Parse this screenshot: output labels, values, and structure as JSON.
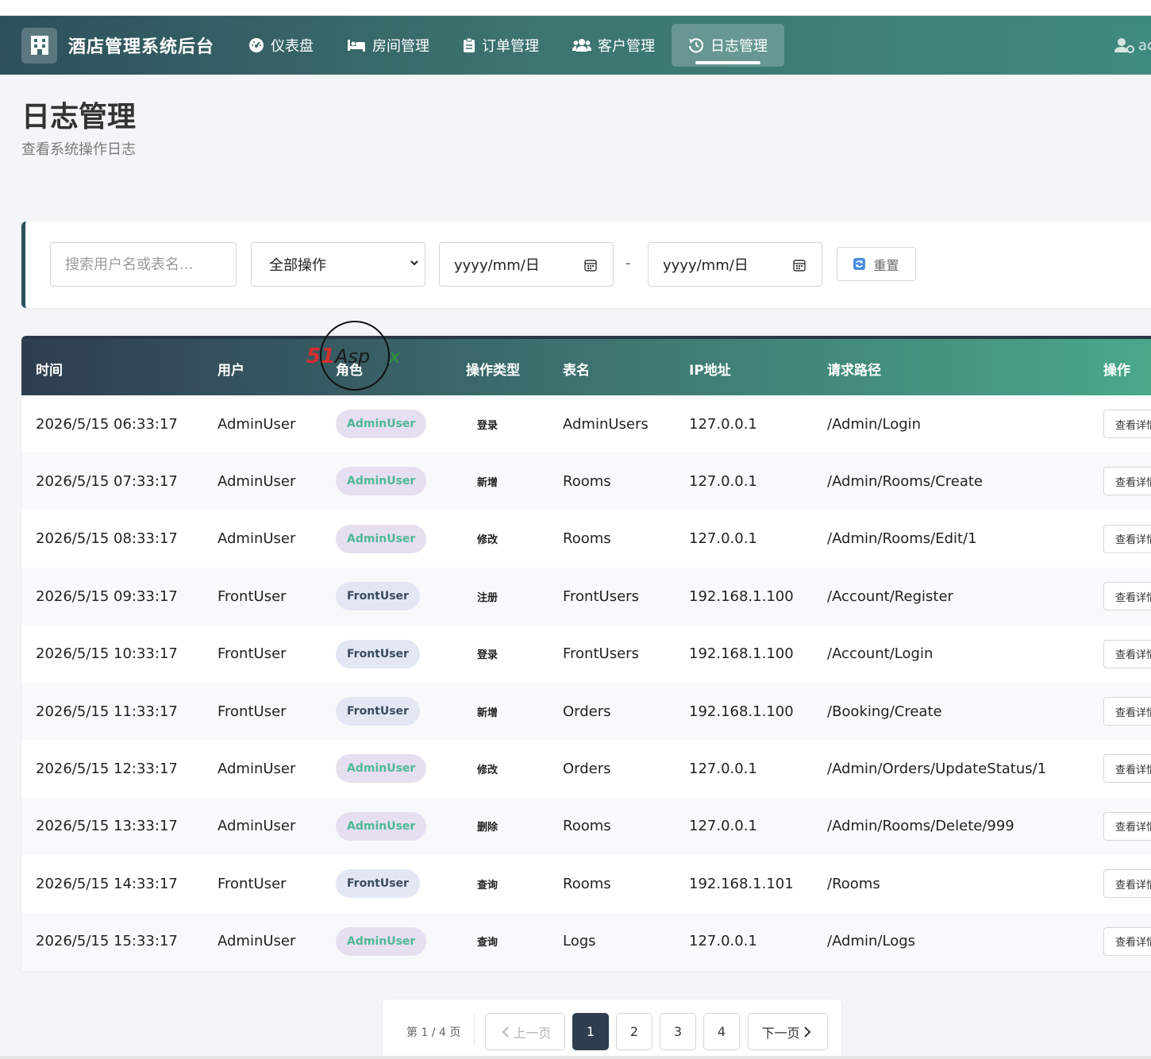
{
  "app": {
    "brand_title": "酒店管理系统后台",
    "user_label": "ac"
  },
  "nav": {
    "items": [
      {
        "label": "仪表盘",
        "icon": "gauge-icon"
      },
      {
        "label": "房间管理",
        "icon": "bed-icon"
      },
      {
        "label": "订单管理",
        "icon": "clipboard-icon"
      },
      {
        "label": "客户管理",
        "icon": "users-icon"
      },
      {
        "label": "日志管理",
        "icon": "history-icon",
        "active": true
      }
    ]
  },
  "page": {
    "title": "日志管理",
    "subtitle": "查看系统操作日志"
  },
  "filters": {
    "search_placeholder": "搜索用户名或表名...",
    "operation_select": "全部操作",
    "date_start": "yyyy/mm/日",
    "date_separator": "-",
    "date_end": "yyyy/mm/日",
    "reset_label": "重置"
  },
  "table": {
    "headers": [
      "时间",
      "用户",
      "角色",
      "操作类型",
      "表名",
      "IP地址",
      "请求路径",
      "操作"
    ],
    "detail_label": "查看详情",
    "rows": [
      {
        "time": "2026/5/15 06:33:17",
        "user": "AdminUser",
        "role": "AdminUser",
        "op": "登录",
        "table": "AdminUsers",
        "ip": "127.0.0.1",
        "path": "/Admin/Login"
      },
      {
        "time": "2026/5/15 07:33:17",
        "user": "AdminUser",
        "role": "AdminUser",
        "op": "新增",
        "table": "Rooms",
        "ip": "127.0.0.1",
        "path": "/Admin/Rooms/Create"
      },
      {
        "time": "2026/5/15 08:33:17",
        "user": "AdminUser",
        "role": "AdminUser",
        "op": "修改",
        "table": "Rooms",
        "ip": "127.0.0.1",
        "path": "/Admin/Rooms/Edit/1"
      },
      {
        "time": "2026/5/15 09:33:17",
        "user": "FrontUser",
        "role": "FrontUser",
        "op": "注册",
        "table": "FrontUsers",
        "ip": "192.168.1.100",
        "path": "/Account/Register"
      },
      {
        "time": "2026/5/15 10:33:17",
        "user": "FrontUser",
        "role": "FrontUser",
        "op": "登录",
        "table": "FrontUsers",
        "ip": "192.168.1.100",
        "path": "/Account/Login"
      },
      {
        "time": "2026/5/15 11:33:17",
        "user": "FrontUser",
        "role": "FrontUser",
        "op": "新增",
        "table": "Orders",
        "ip": "192.168.1.100",
        "path": "/Booking/Create"
      },
      {
        "time": "2026/5/15 12:33:17",
        "user": "AdminUser",
        "role": "AdminUser",
        "op": "修改",
        "table": "Orders",
        "ip": "127.0.0.1",
        "path": "/Admin/Orders/UpdateStatus/1"
      },
      {
        "time": "2026/5/15 13:33:17",
        "user": "AdminUser",
        "role": "AdminUser",
        "op": "删除",
        "table": "Rooms",
        "ip": "127.0.0.1",
        "path": "/Admin/Rooms/Delete/999"
      },
      {
        "time": "2026/5/15 14:33:17",
        "user": "FrontUser",
        "role": "FrontUser",
        "op": "查询",
        "table": "Rooms",
        "ip": "192.168.1.101",
        "path": "/Rooms"
      },
      {
        "time": "2026/5/15 15:33:17",
        "user": "AdminUser",
        "role": "AdminUser",
        "op": "查询",
        "table": "Logs",
        "ip": "127.0.0.1",
        "path": "/Admin/Logs"
      }
    ]
  },
  "pagination": {
    "info": "第 1 / 4 页",
    "prev_label": "上一页",
    "next_label": "下一页",
    "pages": [
      "1",
      "2",
      "3",
      "4"
    ],
    "current": "1"
  },
  "watermark": {
    "text": "51Aspx"
  },
  "colors": {
    "nav_start": "#2e4f5a",
    "nav_end": "#3f8a7e",
    "admin_badge_bg": "#e6dff0",
    "admin_badge_text": "#4fb894",
    "front_badge_bg": "#e3e7f4",
    "front_badge_text": "#3b4b5c",
    "current_page_bg": "#2e3e4f"
  }
}
